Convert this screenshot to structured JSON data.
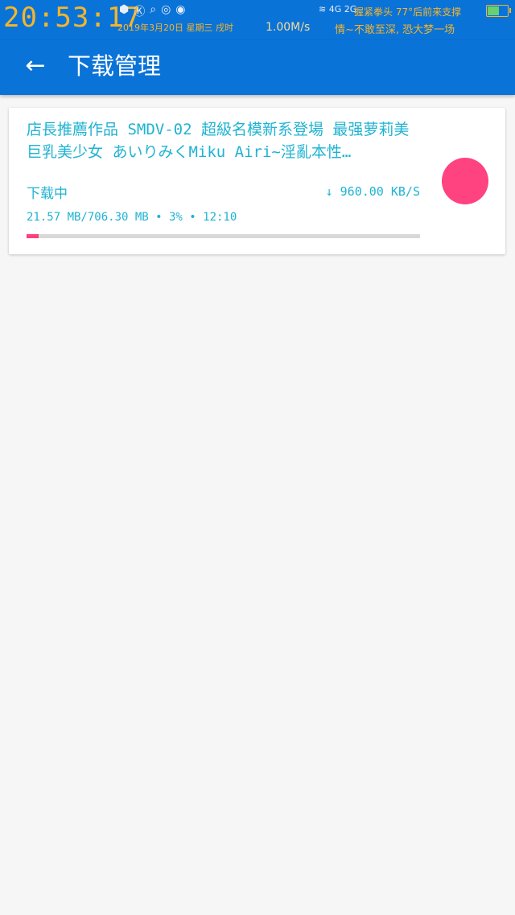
{
  "status_bar": {
    "time": "20:53:17",
    "date": "2019年3月20日 星期三 戌时",
    "net_speed": "1.00M/s",
    "signal": "4G 2G",
    "ticker_line1": "握紧拳头 77°后前来支撑",
    "ticker_line2": "情~不敢至深, 恐大梦一场",
    "icons": [
      "hex-icon",
      "k-circle-icon",
      "search-icon",
      "wechat-icon",
      "app-icon",
      "wifi-icon",
      "battery-icon"
    ],
    "battery_level": 0.6
  },
  "app_bar": {
    "title": "下载管理",
    "back_icon": "arrow-left-icon"
  },
  "downloads": [
    {
      "title": "店長推薦作品 SMDV-02 超級名模新系登場 最强萝莉美巨乳美少女 あいりみくMiku Airi~淫亂本性…",
      "state": "下载中",
      "speed": "↓ 960.00 KB/S",
      "meta": "21.57 MB/706.30 MB • 3% • 12:10",
      "progress": 0.03,
      "action_color": "#ff4280"
    }
  ],
  "colors": {
    "primary": "#0a73d8",
    "accent_text": "#1fb3d2",
    "progress_fill": "#ff3f7a",
    "background": "#f6f6f6"
  }
}
